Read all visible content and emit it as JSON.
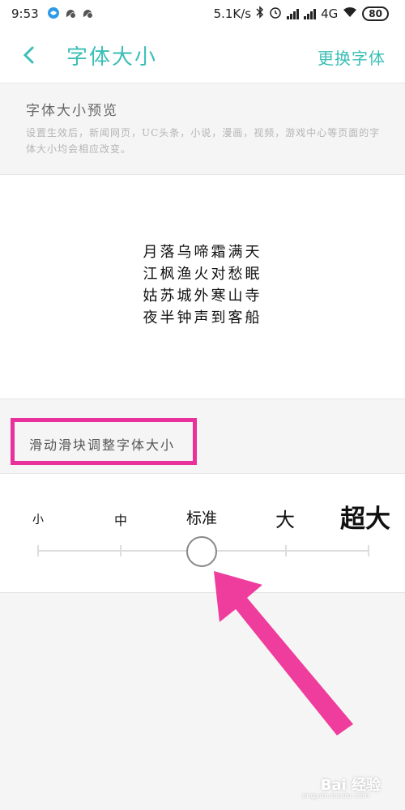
{
  "status_bar": {
    "time": "9:53",
    "network_speed": "5.1K/s",
    "network_type": "4G",
    "battery": "80",
    "icons": [
      "app-notification-icon",
      "app-icon",
      "app-icon",
      "bluetooth-icon",
      "alarm-icon",
      "signal-icon",
      "signal-icon",
      "wifi-icon",
      "battery-icon"
    ]
  },
  "header": {
    "title": "字体大小",
    "change_font": "更换字体"
  },
  "preview": {
    "section_title": "字体大小预览",
    "description": "设置生效后，新闻网页，UC头条，小说，漫画，视频，游戏中心等页面的字体大小均会相应改变。",
    "poem_lines": [
      "月落乌啼霜满天",
      "江枫渔火对愁眠",
      "姑苏城外寒山寺",
      "夜半钟声到客船"
    ]
  },
  "slider": {
    "hint": "滑动滑块调整字体大小",
    "labels": [
      "小",
      "中",
      "标准",
      "大",
      "超大"
    ],
    "selected_label": "标准",
    "selected_index": 2,
    "thumb_fraction": 0.5
  },
  "annotation": {
    "highlight_color": "#e8319b",
    "arrow_color": "#ee3d9c"
  },
  "watermark": {
    "text": "Bai 经验",
    "sub": "jingyan.baidu.com"
  },
  "colors": {
    "accent": "#3bbfb6"
  }
}
